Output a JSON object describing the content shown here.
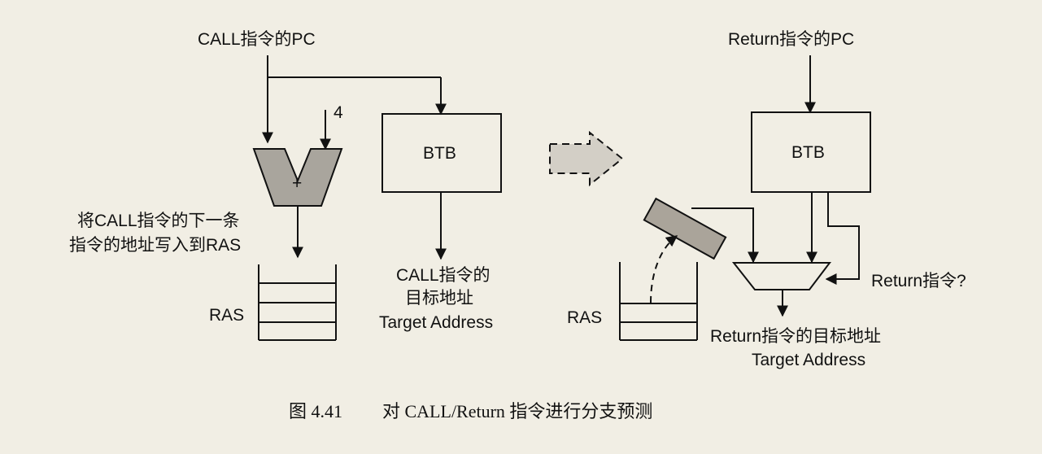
{
  "left": {
    "pc_label": "CALL指令的PC",
    "increment_value": "4",
    "adder_symbol": "+",
    "btb_label": "BTB",
    "write_note_line1": "将CALL指令的下一条",
    "write_note_line2": "指令的地址写入到RAS",
    "ras_label": "RAS",
    "target_line1": "CALL指令的",
    "target_line2": "目标地址",
    "target_line3": "Target Address"
  },
  "right": {
    "pc_label": "Return指令的PC",
    "btb_label": "BTB",
    "ras_label": "RAS",
    "select_label": "Return指令?",
    "target_line1": "Return指令的目标地址",
    "target_line2": "Target Address"
  },
  "caption": {
    "figure_number": "图 4.41",
    "text": "对 CALL/Return 指令进行分支预测"
  },
  "colors": {
    "background": "#f1eee4",
    "adder_fill": "#a9a59d",
    "register_fill": "#aaa49a",
    "arrow_fill": "#d3cfc6",
    "line": "#111111"
  }
}
